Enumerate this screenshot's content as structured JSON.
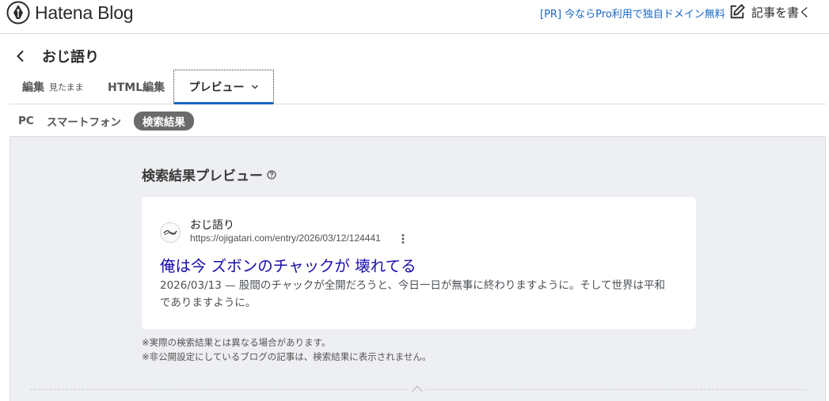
{
  "app": {
    "logo_text": "Hatena Blog",
    "pr_link": "[PR] 今ならPro利用で独自ドメイン無料",
    "write_label": "記事を書く"
  },
  "header": {
    "blog_title": "おじ語り"
  },
  "edit_tabs": [
    {
      "label": "編集",
      "sub": "見たまま"
    },
    {
      "label": "HTML編集",
      "sub": ""
    },
    {
      "label": "プレビュー",
      "sub": ""
    }
  ],
  "preview_tabs": [
    {
      "label": "PC"
    },
    {
      "label": "スマートフォン"
    },
    {
      "label": "検索結果",
      "active": true
    }
  ],
  "preview": {
    "heading": "検索結果プレビュー",
    "result": {
      "site_name": "おじ語り",
      "url": "https://ojigatari.com/entry/2026/03/12/124441",
      "title": "俺は今 ズボンのチャックが 壊れてる",
      "date": "2026/03/13",
      "snippet": "股間のチャックが全開だろうと、今日一日が無事に終わりますように。そして世界は平和でありますように。"
    },
    "notes": [
      "※実際の検索結果とは異なる場合があります。",
      "※非公開設定にしているブログの記事は、検索結果に表示されません。"
    ]
  },
  "colors": {
    "link_blue": "#1a66c7",
    "result_title": "#1a0dab",
    "active_pill": "#6b6b6b",
    "preview_bg": "#eeeff2"
  },
  "icons": [
    "hatena-pen-icon",
    "edit-square-icon",
    "chevron-left-icon",
    "chevron-down-icon",
    "help-circle-icon",
    "favicon-icon",
    "kebab-menu-icon",
    "chevron-up-icon"
  ]
}
